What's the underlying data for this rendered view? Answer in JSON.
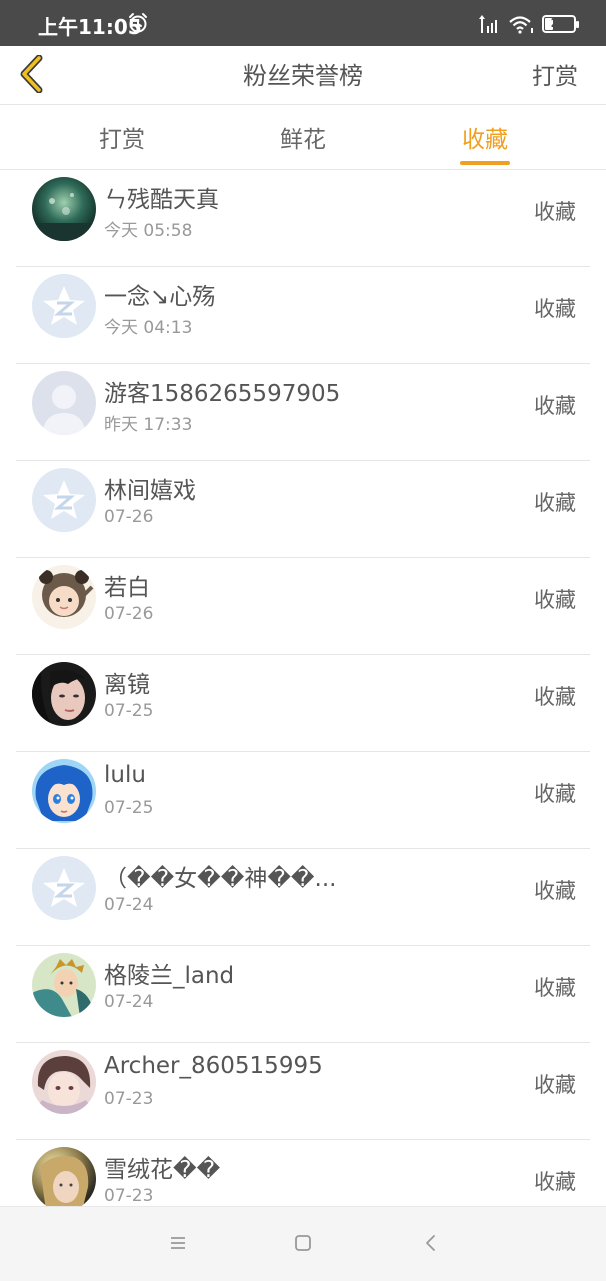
{
  "status_bar": {
    "time": "上午11:05",
    "battery": "29",
    "battery_fraction": 0.29,
    "alarm_icon": "alarm-clock-icon",
    "signal_icon": "signal-icon",
    "wifi_icon": "wifi-icon"
  },
  "header": {
    "title": "粉丝荣誉榜",
    "right_action": "打赏",
    "back_icon": "chevron-left-icon"
  },
  "tabs": [
    {
      "label": "打赏",
      "active": false
    },
    {
      "label": "鲜花",
      "active": false
    },
    {
      "label": "收藏",
      "active": true
    }
  ],
  "accent_color": "#f0a020",
  "list": [
    {
      "name": "ㄣ残酷天真",
      "time": "今天 05:58",
      "action": "收藏",
      "avatar": "forest"
    },
    {
      "name": "一念↘心殇",
      "time": "今天 04:13",
      "action": "收藏",
      "avatar": "default-qq"
    },
    {
      "name": "游客1586265597905",
      "time": "昨天 17:33",
      "action": "收藏",
      "avatar": "default-person"
    },
    {
      "name": "林间嬉戏",
      "time": "07-26",
      "action": "收藏",
      "avatar": "default-qq"
    },
    {
      "name": "若白",
      "time": "07-26",
      "action": "收藏",
      "avatar": "panda-hood"
    },
    {
      "name": "离镜",
      "time": "07-25",
      "action": "收藏",
      "avatar": "girl-portrait"
    },
    {
      "name": "lulu",
      "time": "07-25",
      "action": "收藏",
      "avatar": "anime-blue-hair"
    },
    {
      "name": "（��女��神��...",
      "time": "07-24",
      "action": "收藏",
      "avatar": "default-qq"
    },
    {
      "name": "格陵兰_land",
      "time": "07-24",
      "action": "收藏",
      "avatar": "fantasy-character"
    },
    {
      "name": "Archer_860515995",
      "time": "07-23",
      "action": "收藏",
      "avatar": "anime-boy"
    },
    {
      "name": "雪绒花��",
      "time": "07-23",
      "action": "收藏",
      "avatar": "sunlit-girl"
    }
  ],
  "nav_bar": {
    "menu_icon": "menu-icon",
    "home_icon": "home-square-icon",
    "back_icon": "back-triangle-icon"
  }
}
